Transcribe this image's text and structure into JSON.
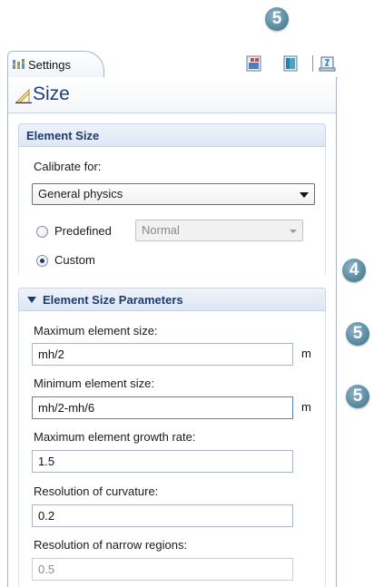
{
  "callouts": {
    "top": "5",
    "custom": "4",
    "max_size": "5",
    "min_size": "5"
  },
  "tab": {
    "label": "Settings"
  },
  "toolbar": {
    "icons": [
      "build-selected-icon",
      "build-all-icon",
      "help-icon"
    ]
  },
  "panel": {
    "title": "Size"
  },
  "element_size": {
    "header": "Element Size",
    "calibrate_label": "Calibrate for:",
    "calibrate_value": "General physics",
    "predefined_label": "Predefined",
    "predefined_value": "Normal",
    "custom_label": "Custom",
    "selected": "Custom"
  },
  "parameters": {
    "header": "Element Size Parameters",
    "max_size_label": "Maximum element size:",
    "max_size_value": "mh/2",
    "min_size_label": "Minimum element size:",
    "min_size_value": "mh/2-mh/6",
    "growth_label": "Maximum element growth rate:",
    "growth_value": "1.5",
    "curvature_label": "Resolution of curvature:",
    "curvature_value": "0.2",
    "narrow_label": "Resolution of narrow regions:",
    "narrow_value": "0.5",
    "unit": "m"
  }
}
